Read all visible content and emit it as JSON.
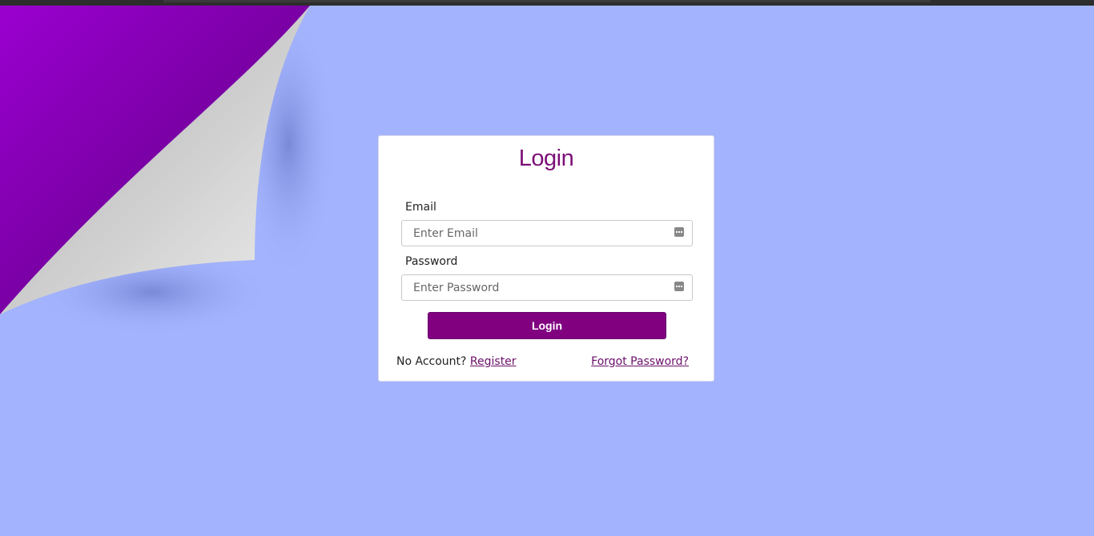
{
  "login": {
    "title": "Login",
    "email_label": "Email",
    "email_placeholder": "Enter Email",
    "password_label": "Password",
    "password_placeholder": "Enter Password",
    "submit_label": "Login",
    "no_account_text": "No Account?",
    "register_link": "Register",
    "forgot_link": "Forgot Password?"
  },
  "colors": {
    "background": "#a3b3fd",
    "accent": "#800080",
    "title": "#7b0f77"
  },
  "icons": {
    "field_icon": "password-manager-key-icon"
  }
}
